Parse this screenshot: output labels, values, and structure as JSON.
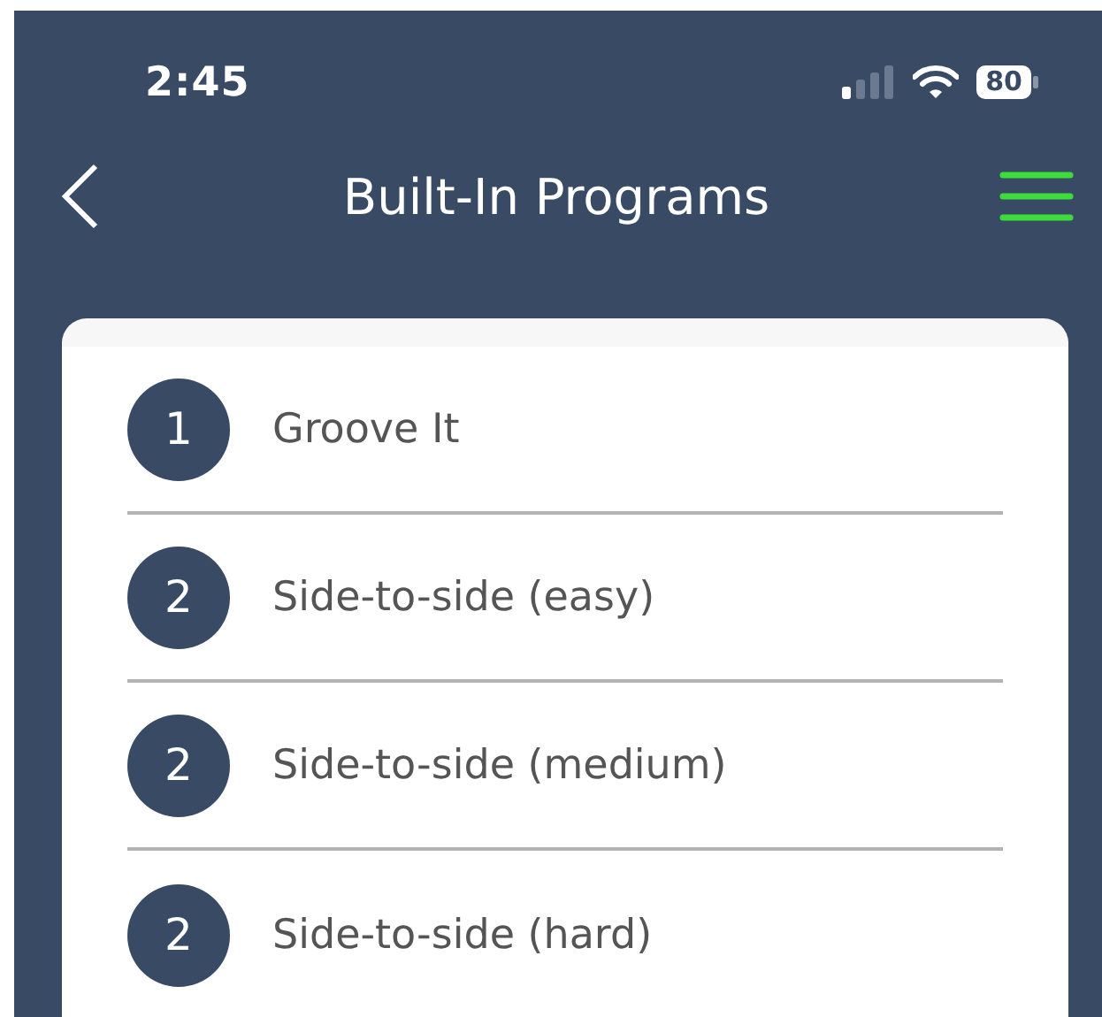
{
  "status_bar": {
    "time": "2:45",
    "battery": "80"
  },
  "nav": {
    "title": "Built-In Programs"
  },
  "programs": [
    {
      "number": "1",
      "name": "Groove It"
    },
    {
      "number": "2",
      "name": "Side-to-side (easy)"
    },
    {
      "number": "2",
      "name": "Side-to-side (medium)"
    },
    {
      "number": "2",
      "name": "Side-to-side (hard)"
    }
  ]
}
